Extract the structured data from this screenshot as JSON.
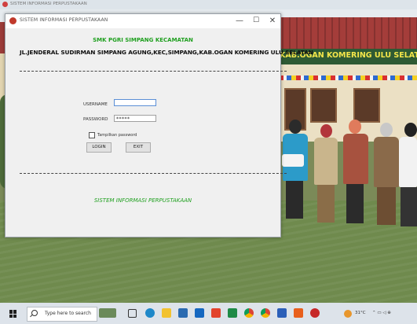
{
  "background": {
    "caption": "SISTEM INFORMASI PERPUSTAKAAN",
    "banner_text": "KAB.OGAN KOMERING ULU SELATAN"
  },
  "window": {
    "title": "SISTEM INFORMASI PERPUSTAKAAN",
    "controls": {
      "minimize": "—",
      "maximize": "☐",
      "close": "✕"
    }
  },
  "header": {
    "school_name": "SMK PGRI SIMPANG KECAMATAN",
    "address": "JL.JENDERAL SUDIRMAN SIMPANG AGUNG,KEC,SIMPANG,KAB.OGAN KOMERING ULU SELATAN"
  },
  "login": {
    "username_label": "USERNAME",
    "username_value": "",
    "password_label": "PASSWORD",
    "password_value": "*****",
    "show_password_label": "Tampilkan password",
    "login_button": "LOGIN",
    "exit_button": "EXIT"
  },
  "footer": {
    "text": "SISTEM INFORMASI PERPUSTAKAAN"
  },
  "taskbar": {
    "search_placeholder": "Type here to search",
    "tray_text": "31°C",
    "icons": [
      "weather-icon",
      "task-view-icon",
      "edge-icon",
      "file-explorer-icon",
      "store-icon",
      "mail-icon",
      "office-icon",
      "excel-icon",
      "chrome-icon",
      "chrome-icon",
      "word-icon",
      "vlc-icon",
      "app-icon"
    ]
  }
}
